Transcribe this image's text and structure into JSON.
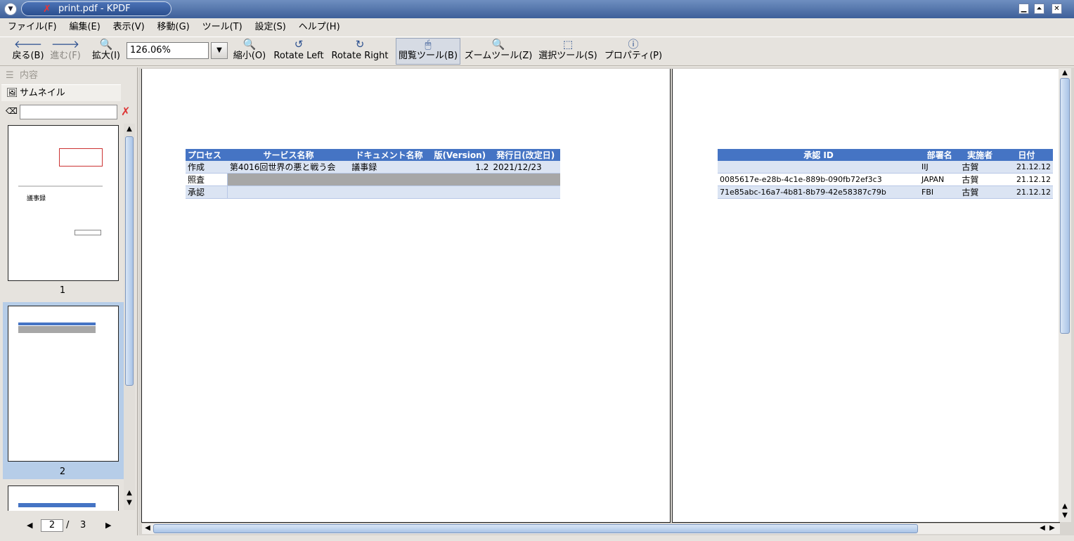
{
  "window": {
    "title": "print.pdf - KPDF",
    "buttons": {
      "minimize": "▁",
      "maximize": "⏶",
      "close": "✕"
    },
    "app_icon": "pdf-icon"
  },
  "menu": [
    "ファイル(F)",
    "編集(E)",
    "表示(V)",
    "移動(G)",
    "ツール(T)",
    "設定(S)",
    "ヘルプ(H)"
  ],
  "toolbar": {
    "back": "戻る(B)",
    "forward": "進む(F)",
    "zoom_in": "拡大(I)",
    "zoom_value": "126.06%",
    "zoom_out": "縮小(O)",
    "rotate_left": "Rotate Left",
    "rotate_right": "Rotate Right",
    "browse_tool": "閲覧ツール(B)",
    "zoom_tool": "ズームツール(Z)",
    "select_tool": "選択ツール(S)",
    "properties": "プロパティ(P)"
  },
  "sidebar": {
    "tab_contents": "内容",
    "tab_thumbnails": "サムネイル",
    "search_value": "",
    "thumbnails": [
      {
        "page": "1",
        "lines": [
          "議事録"
        ]
      },
      {
        "page": "2",
        "selected": true
      },
      {
        "page": "3"
      }
    ],
    "pager": {
      "current": "2",
      "separator": "/",
      "total": "3"
    }
  },
  "page_left": {
    "headers": [
      "プロセス",
      "サービス名称",
      "ドキュメント名称",
      "版(Version)",
      "発行日(改定日)"
    ],
    "rows": [
      {
        "process": "作成",
        "service": "第4016回世界の悪と戦う会",
        "document": "議事録",
        "version": "1.2",
        "date": "2021/12/23"
      },
      {
        "process": "照査"
      },
      {
        "process": "承認"
      }
    ]
  },
  "page_right": {
    "headers": [
      "承認 ID",
      "部署名",
      "実施者",
      "日付"
    ],
    "rows": [
      {
        "id": "",
        "dept": "IIJ",
        "person": "古賀",
        "date": "21.12.12"
      },
      {
        "id": "0085617e-e28b-4c1e-889b-090fb72ef3c3",
        "dept": "JAPAN",
        "person": "古賀",
        "date": "21.12.12"
      },
      {
        "id": "71e85abc-16a7-4b81-8b79-42e58387c79b",
        "dept": "FBI",
        "person": "古賀",
        "date": "21.12.12"
      }
    ]
  },
  "colors": {
    "table_header": "#4574c4",
    "redaction": "#a7a7a7",
    "selection": "#b6cde8"
  }
}
